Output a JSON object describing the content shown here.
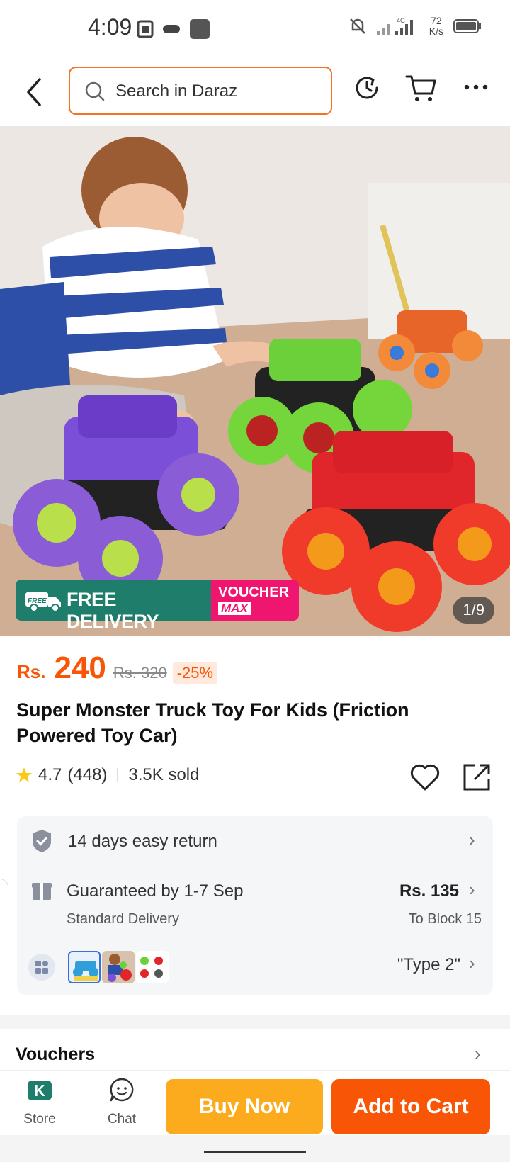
{
  "status_bar": {
    "time": "4:09",
    "network_type": "4G",
    "net_speed_value": "72",
    "net_speed_unit": "K/s"
  },
  "header": {
    "search_placeholder": "Search in Daraz",
    "icons": [
      "back-icon",
      "search-icon",
      "history-icon",
      "cart-icon",
      "more-icon"
    ]
  },
  "hero": {
    "free_delivery_tag": "FREE",
    "free_delivery": "FREE DELIVERY",
    "voucher_line1": "VOUCHER",
    "voucher_line2": "MAX",
    "pager": "1/9"
  },
  "price": {
    "currency": "Rs.",
    "amount": "240",
    "original": "Rs. 320",
    "discount": "-25%"
  },
  "product": {
    "title": "Super Monster Truck Toy For Kids (Friction Powered Toy Car)",
    "rating": "4.7",
    "reviews": "(448)",
    "sold": "3.5K sold"
  },
  "info": {
    "return_text": "14 days easy return",
    "delivery_text": "Guaranteed by 1-7 Sep",
    "delivery_type": "Standard Delivery",
    "delivery_price": "Rs. 135",
    "delivery_location": "To Block 15",
    "variant_selected": "\"Type 2\""
  },
  "vouchers": {
    "label": "Vouchers"
  },
  "bottom_bar": {
    "store_label": "Store",
    "chat_label": "Chat",
    "buy_now": "Buy Now",
    "add_to_cart": "Add to Cart"
  },
  "colors": {
    "brand_orange": "#f85606",
    "buy_yellow": "#fcab1e",
    "free_delivery_green": "#1f7e6b",
    "voucher_pink": "#f0166f"
  }
}
